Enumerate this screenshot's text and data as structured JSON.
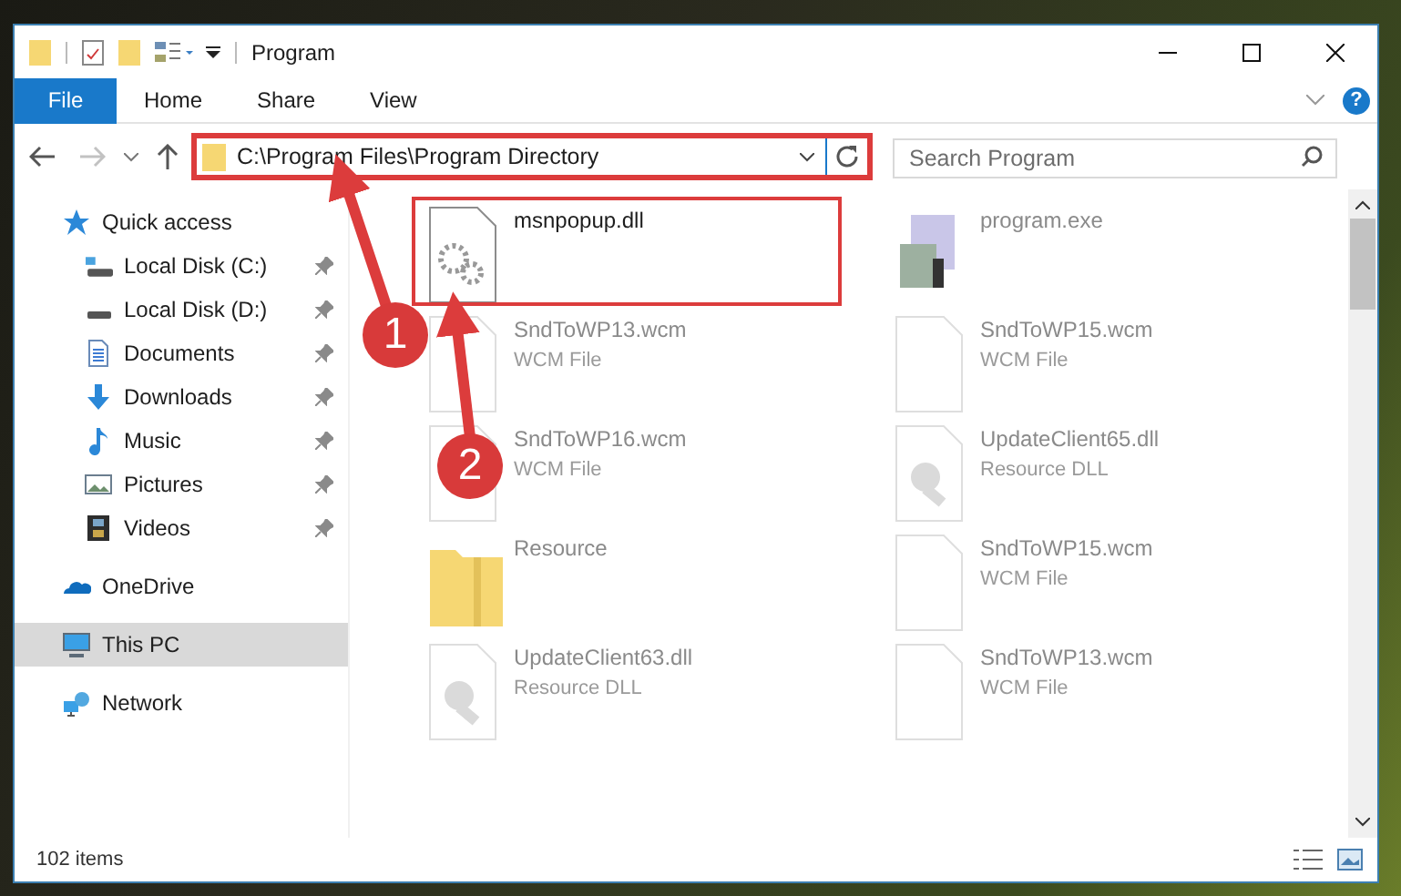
{
  "window": {
    "title": "Program"
  },
  "ribbon_tabs": [
    {
      "label": "File",
      "selected": true
    },
    {
      "label": "Home",
      "selected": false
    },
    {
      "label": "Share",
      "selected": false
    },
    {
      "label": "View",
      "selected": false
    }
  ],
  "address_bar": {
    "path": "C:\\Program Files\\Program Directory"
  },
  "help_button": {
    "label": "?"
  },
  "search": {
    "placeholder": "Search Program"
  },
  "sidebar": {
    "items": [
      {
        "label": "Quick access",
        "kind": "star",
        "selected": false,
        "children": [
          {
            "label": "Local Disk (C:)",
            "kind": "sysdrive",
            "pinned": true,
            "selected": false
          },
          {
            "label": "Local Disk (D:)",
            "kind": "drive",
            "pinned": true,
            "selected": false
          },
          {
            "label": "Documents",
            "kind": "documents",
            "pinned": true,
            "selected": false
          },
          {
            "label": "Downloads",
            "kind": "downloads",
            "pinned": true,
            "selected": false
          },
          {
            "label": "Music",
            "kind": "music",
            "pinned": true,
            "selected": false
          },
          {
            "label": "Pictures",
            "kind": "pictures",
            "pinned": true,
            "selected": false
          },
          {
            "label": "Videos",
            "kind": "videos",
            "pinned": true,
            "selected": false
          }
        ]
      },
      {
        "label": "OneDrive",
        "kind": "cloud",
        "selected": false
      },
      {
        "label": "This PC",
        "kind": "computer",
        "selected": true
      },
      {
        "label": "Network",
        "kind": "network",
        "selected": false
      }
    ]
  },
  "files": [
    {
      "name": "msnpopup.dll",
      "kind": "dll",
      "highlighted": true
    },
    {
      "name": "program.exe",
      "kind": "exe",
      "highlighted": false
    },
    {
      "name": "SndToWP13.wcm",
      "type": "WCM File",
      "kind": "blank",
      "highlighted": false
    },
    {
      "name": "SndToWP15.wcm",
      "type": "WCM File",
      "kind": "blank",
      "highlighted": false
    },
    {
      "name": "SndToWP16.wcm",
      "type": "WCM File",
      "kind": "blank",
      "highlighted": false
    },
    {
      "name": "UpdateClient65.dll",
      "type": "Resource DLL",
      "kind": "resource",
      "highlighted": false
    },
    {
      "name": "Resource",
      "kind": "folder",
      "highlighted": false
    },
    {
      "name": "SndToWP15.wcm",
      "type": "WCM File",
      "kind": "blank",
      "highlighted": false
    },
    {
      "name": "UpdateClient63.dll",
      "type": "Resource DLL",
      "kind": "resource",
      "highlighted": false
    },
    {
      "name": "SndToWP13.wcm",
      "type": "WCM File",
      "kind": "blank",
      "highlighted": false
    }
  ],
  "status_bar": {
    "count": "102 items"
  },
  "annotations": [
    {
      "label": "1"
    },
    {
      "label": "2"
    }
  ]
}
